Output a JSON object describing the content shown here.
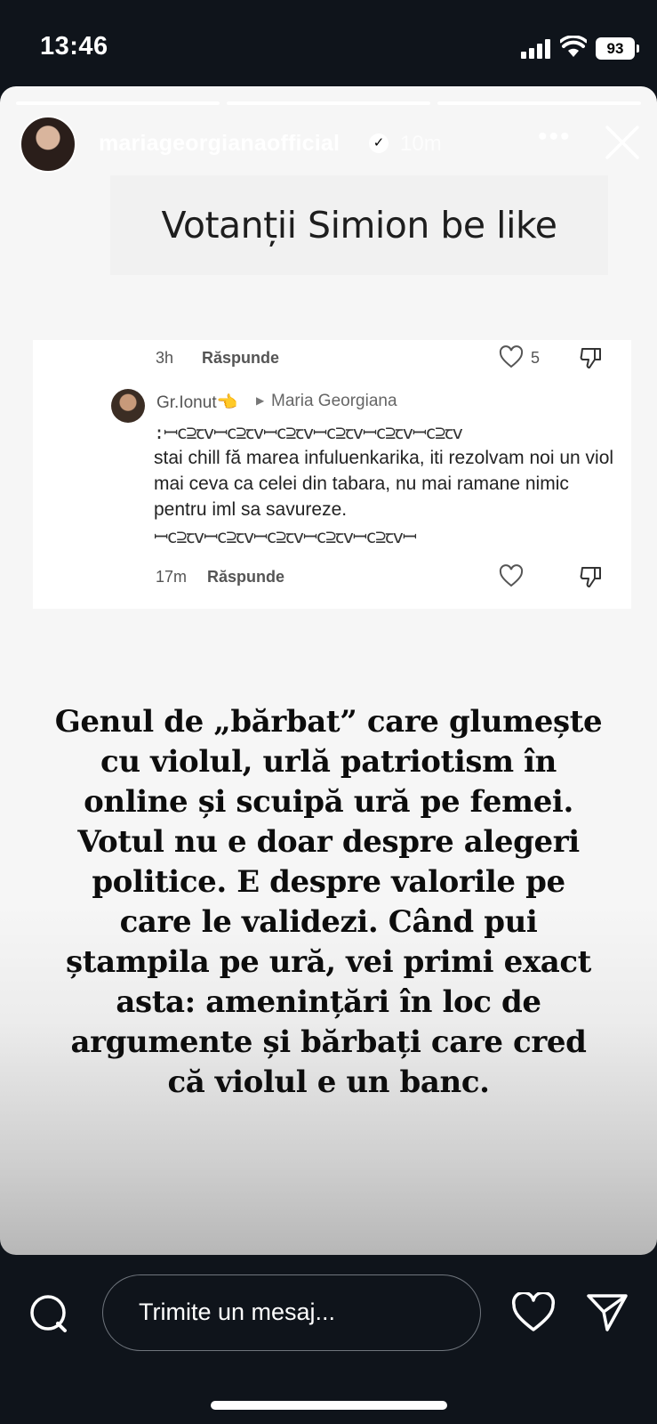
{
  "status_bar": {
    "time": "13:46",
    "battery": "93"
  },
  "story": {
    "username": "mariageorgianaofficial",
    "verified_icon": "✓",
    "time_ago": "10m",
    "more_icon": "•••",
    "caption": "Votanții Simion be like",
    "comment": {
      "prev_time": "3h",
      "prev_reply": "Răspunde",
      "prev_likes": "5",
      "user": "Gr.Ionut",
      "user_emoji": "👈",
      "arrow": "▶",
      "reply_to": "Maria Georgiana",
      "symbols_line1": ":ꟷⅽ⊇ꞇⅴꟷⅽ⊇ꞇⅴꟷⅽ⊇ꞇⅴꟷⅽ⊇ꞇⅴꟷⅽ⊇ꞇⅴꟷⅽ⊇ꞇⅴ",
      "text": "stai chill fă marea infuluenkarika, iti rezolvam noi un viol mai ceva ca celei din tabara, nu mai ramane nimic pentru iml sa savureze.",
      "symbols_line2": "ꟷⅽ⊇ꞇⅴꟷⅽ⊇ꞇⅴꟷⅽ⊇ꞇⅴꟷⅽ⊇ꞇⅴꟷⅽ⊇ꞇⅴꟷ",
      "time": "17m",
      "reply": "Răspunde"
    },
    "statement": "Genul de „bărbat” care glumește cu violul, urlă patriotism în online și scuipă ură pe femei. Votul nu e doar despre alegeri politice. E despre valorile pe care le validezi. Când pui ștampila pe ură, vei primi exact asta: amenințări în loc de argumente și bărbați care cred că violul e un banc."
  },
  "bottom_bar": {
    "message_placeholder": "Trimite un mesaj..."
  },
  "colors": {
    "background": "#0f141b",
    "story_bg": "#f6f6f6",
    "text_dark": "#0d0d0d"
  },
  "icons": [
    "camera-icon",
    "heart-icon",
    "send-icon",
    "close-icon",
    "more-icon",
    "verified-icon",
    "dislike-icon"
  ]
}
